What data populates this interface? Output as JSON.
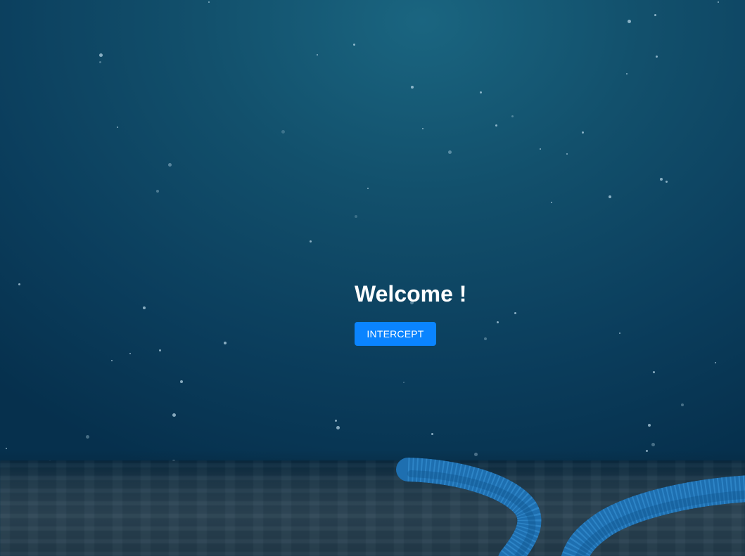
{
  "hero": {
    "heading": "Welcome !",
    "button_label": "INTERCEPT"
  },
  "colors": {
    "button_bg": "#0a84ff",
    "button_text": "#ffffff",
    "heading_text": "#ffffff",
    "water_top": "#1a6580",
    "water_bottom": "#06304d",
    "cable": "#1e6fb0"
  },
  "scene": {
    "background": "underwater-ocean",
    "decorations": [
      "floating-bubbles",
      "sandy-seabed",
      "undersea-cables"
    ]
  }
}
